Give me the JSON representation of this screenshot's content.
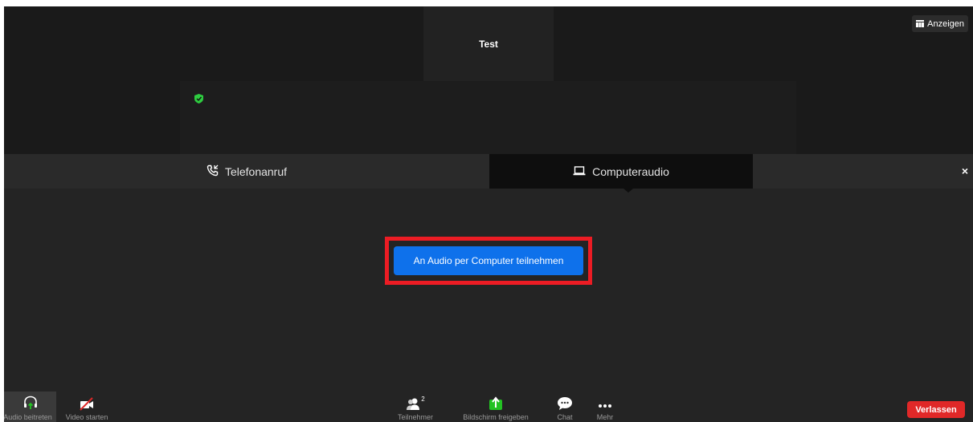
{
  "speaker": {
    "name": "Test"
  },
  "view_button": {
    "label": "Anzeigen",
    "icon": "grid-view-icon"
  },
  "video": {
    "security_icon": "shield-check-icon",
    "security_color": "#2ecc40"
  },
  "audio_panel": {
    "tabs": [
      {
        "label": "Telefonanruf",
        "icon": "phone-icon",
        "active": false
      },
      {
        "label": "Computeraudio",
        "icon": "laptop-icon",
        "active": true
      }
    ],
    "close_label": "×",
    "join_button_label": "An Audio per Computer teilnehmen",
    "highlight_color": "#ec1c24",
    "button_color": "#0e71eb"
  },
  "toolbar": {
    "audio_label": "Audio beitreten",
    "video_label": "Video starten",
    "participants_label": "Teilnehmer",
    "participants_count": "2",
    "share_label": "Bildschirm freigeben",
    "chat_label": "Chat",
    "more_label": "Mehr",
    "leave_label": "Verlassen",
    "leave_color": "#e02828",
    "share_color": "#23c223"
  }
}
